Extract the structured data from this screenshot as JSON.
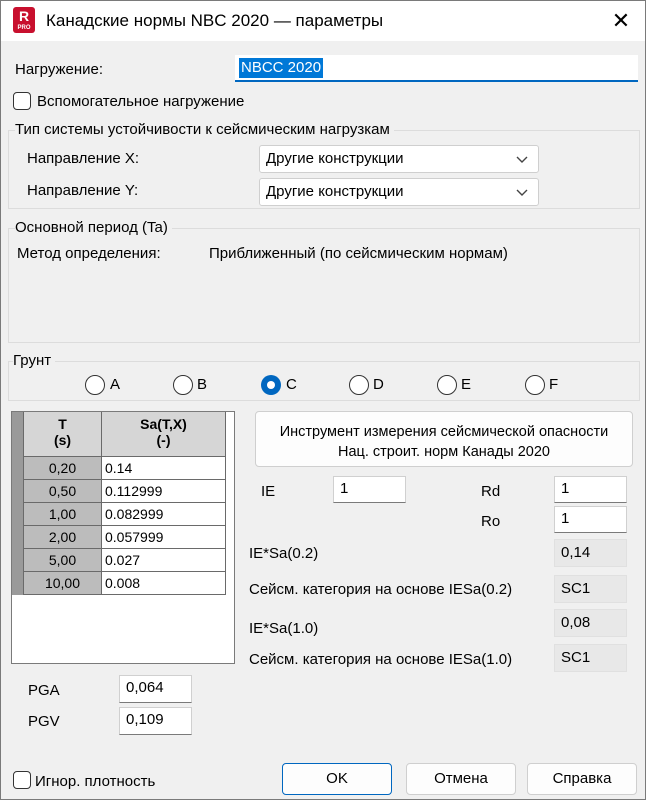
{
  "window": {
    "title": "Канадские нормы NBC 2020 — параметры",
    "icon_letter": "R",
    "icon_sub": "PRO"
  },
  "load": {
    "label": "Нагружение:",
    "value": "NBCC 2020"
  },
  "aux_load": {
    "label": "Вспомогательное нагружение"
  },
  "stability": {
    "title": "Тип системы устойчивости к сейсмическим нагрузкам",
    "dir_x_label": "Направление X:",
    "dir_x_value": "Другие конструкции",
    "dir_y_label": "Направление Y:",
    "dir_y_value": "Другие конструкции"
  },
  "period": {
    "title": "Основной период (Ta)",
    "method_label": "Метод определения:",
    "method_value": "Приближенный (по сейсмическим нормам)"
  },
  "soil": {
    "title": "Грунт",
    "options": [
      "A",
      "B",
      "C",
      "D",
      "E",
      "F"
    ],
    "selected": "C"
  },
  "table": {
    "col_t": [
      "T",
      "(s)"
    ],
    "col_sa": [
      "Sa(T,X)",
      "(-)"
    ],
    "rows": [
      {
        "t": "0,20",
        "sa": "0.14"
      },
      {
        "t": "0,50",
        "sa": "0.112999"
      },
      {
        "t": "1,00",
        "sa": "0.082999"
      },
      {
        "t": "2,00",
        "sa": "0.057999"
      },
      {
        "t": "5,00",
        "sa": "0.027"
      },
      {
        "t": "10,00",
        "sa": "0.008"
      }
    ]
  },
  "tool_button": {
    "line1": "Инструмент измерения сейсмической опасности",
    "line2": "Нац. строит. норм Канады 2020"
  },
  "params": {
    "ie_label": "IE",
    "ie_value": "1",
    "rd_label": "Rd",
    "rd_value": "1",
    "ro_label": "Ro",
    "ro_value": "1",
    "iesa02_label": "IE*Sa(0.2)",
    "iesa02_value": "0,14",
    "cat02_label": "Сейсм. категория на основе IESa(0.2)",
    "cat02_value": "SC1",
    "iesa10_label": "IE*Sa(1.0)",
    "iesa10_value": "0,08",
    "cat10_label": "Сейсм. категория на основе IESa(1.0)",
    "cat10_value": "SC1"
  },
  "pga": {
    "label": "PGA",
    "value": "0,064"
  },
  "pgv": {
    "label": "PGV",
    "value": "0,109"
  },
  "ignore_density": {
    "label": "Игнор. плотность"
  },
  "buttons": {
    "ok": "OK",
    "cancel": "Отмена",
    "help": "Справка"
  },
  "colors": {
    "accent": "#0067c0",
    "selection": "#0078d7",
    "icon_red": "#c8102e"
  }
}
